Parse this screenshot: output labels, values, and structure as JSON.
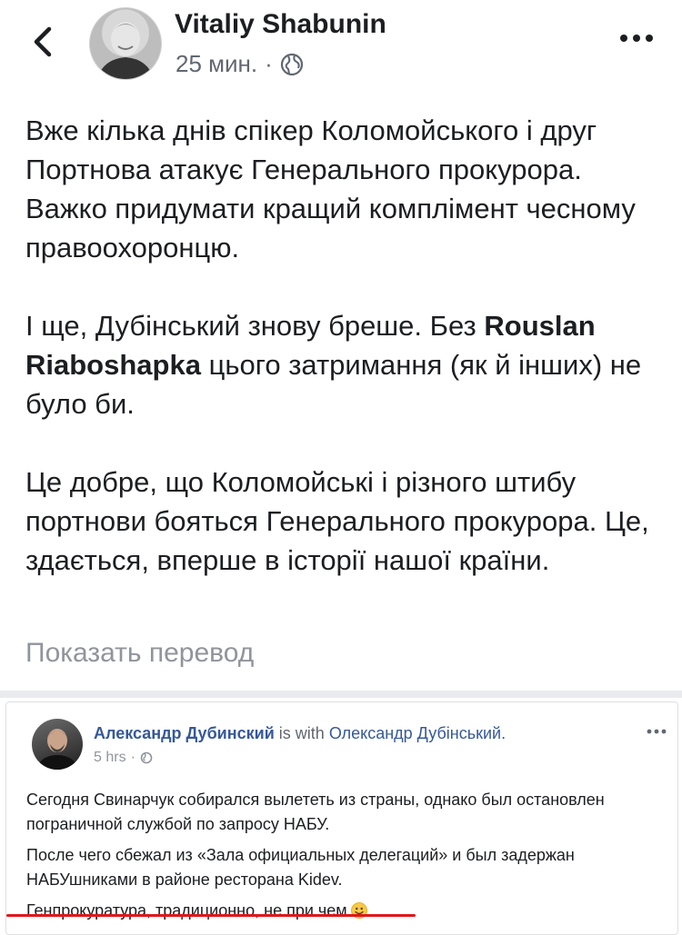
{
  "header": {
    "author": "Vitaliy Shabunin",
    "time": "25 мин.",
    "separator": "·"
  },
  "post": {
    "p1": "Вже кілька днів спікер Коломойського і друг Портнова атакує Генерального прокурора. Важко придумати кращий комплімент чесному правоохоронцю.",
    "p2_pre": "І ще, Дубінський знову бреше. Без ",
    "p2_tag": "Rouslan Riaboshapka",
    "p2_post": " цього затримання (як й інших) не було би.",
    "p3": "Це добре, що Коломойські і різного штибу портнови бояться Генерального прокурора. Це, здається, вперше в історії нашої країни.",
    "translate": "Показать перевод"
  },
  "embedded": {
    "author": "Александр Дубинский",
    "with_text": "is with",
    "tagged": "Олександр Дубінський.",
    "time": "5 hrs",
    "separator": "·",
    "line1": "Сегодня Свинарчук собирался вылететь из страны, однако был остановлен пограничной службой по запросу НАБУ.",
    "line2": "После чего сбежал из «Зала официальных делегаций» и был задержан НАБУшниками в районе ресторана Kidev.",
    "line3": "Генпрокуратура, традиционно, не при чем"
  },
  "icons": {
    "back": "chevron-left-icon",
    "globe": "globe-icon",
    "more": "more-dots-icon",
    "smile": "smiley-emoji-icon"
  },
  "colors": {
    "link": "#365899",
    "muted": "#90949c",
    "underline": "#e0181c",
    "emoji": "#f7c948"
  }
}
